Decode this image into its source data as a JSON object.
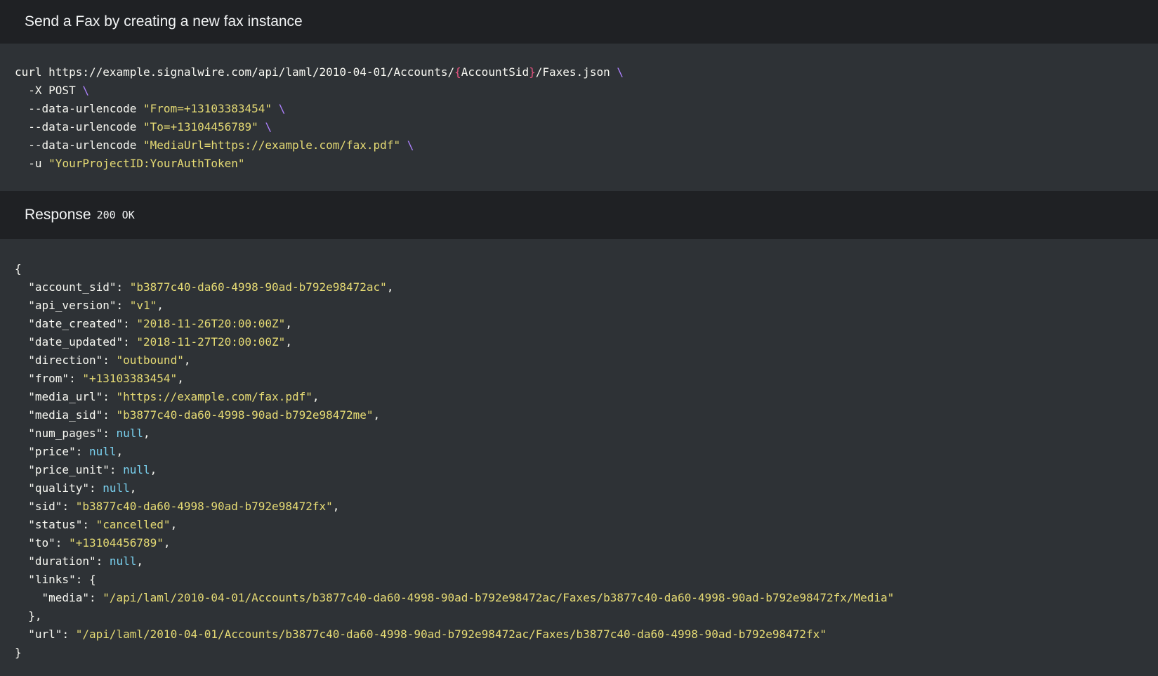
{
  "request": {
    "title": "Send a Fax by creating a new fax instance",
    "curl_lines": [
      {
        "cmd": "curl https://example.signalwire.com/api/laml/2010-04-01/Accounts/",
        "open": "{",
        "var": "AccountSid",
        "close": "}",
        "rest": "/Faxes.json",
        "cont": "\\"
      },
      {
        "indent": "  ",
        "cmd": "-X POST",
        "cont": "\\"
      },
      {
        "indent": "  ",
        "cmd": "--data-urlencode",
        "str": "\"From=+13103383454\"",
        "cont": "\\"
      },
      {
        "indent": "  ",
        "cmd": "--data-urlencode",
        "str": "\"To=+13104456789\"",
        "cont": "\\"
      },
      {
        "indent": "  ",
        "cmd": "--data-urlencode",
        "str": "\"MediaUrl=https://example.com/fax.pdf\"",
        "cont": "\\"
      },
      {
        "indent": "  ",
        "cmd": "-u",
        "str": "\"YourProjectID:YourAuthToken\"",
        "cont": ""
      }
    ]
  },
  "response": {
    "title": "Response",
    "status": "200 OK",
    "open_brace": "{",
    "close_brace": "}",
    "fields": [
      {
        "key": "\"account_sid\"",
        "value": "\"b3877c40-da60-4998-90ad-b792e98472ac\"",
        "type": "str"
      },
      {
        "key": "\"api_version\"",
        "value": "\"v1\"",
        "type": "str"
      },
      {
        "key": "\"date_created\"",
        "value": "\"2018-11-26T20:00:00Z\"",
        "type": "str"
      },
      {
        "key": "\"date_updated\"",
        "value": "\"2018-11-27T20:00:00Z\"",
        "type": "str"
      },
      {
        "key": "\"direction\"",
        "value": "\"outbound\"",
        "type": "str"
      },
      {
        "key": "\"from\"",
        "value": "\"+13103383454\"",
        "type": "str"
      },
      {
        "key": "\"media_url\"",
        "value": "\"https://example.com/fax.pdf\"",
        "type": "str"
      },
      {
        "key": "\"media_sid\"",
        "value": "\"b3877c40-da60-4998-90ad-b792e98472me\"",
        "type": "str"
      },
      {
        "key": "\"num_pages\"",
        "value": "null",
        "type": "null"
      },
      {
        "key": "\"price\"",
        "value": "null",
        "type": "null"
      },
      {
        "key": "\"price_unit\"",
        "value": "null",
        "type": "null"
      },
      {
        "key": "\"quality\"",
        "value": "null",
        "type": "null"
      },
      {
        "key": "\"sid\"",
        "value": "\"b3877c40-da60-4998-90ad-b792e98472fx\"",
        "type": "str"
      },
      {
        "key": "\"status\"",
        "value": "\"cancelled\"",
        "type": "str"
      },
      {
        "key": "\"to\"",
        "value": "\"+13104456789\"",
        "type": "str"
      },
      {
        "key": "\"duration\"",
        "value": "null",
        "type": "null"
      }
    ],
    "links": {
      "key": "\"links\"",
      "media_key": "\"media\"",
      "media_value": "\"/api/laml/2010-04-01/Accounts/b3877c40-da60-4998-90ad-b792e98472ac/Faxes/b3877c40-da60-4998-90ad-b792e98472fx/Media\""
    },
    "url": {
      "key": "\"url\"",
      "value": "\"/api/laml/2010-04-01/Accounts/b3877c40-da60-4998-90ad-b792e98472ac/Faxes/b3877c40-da60-4998-90ad-b792e98472fx\""
    }
  },
  "colors": {
    "header_bg": "#1f2124",
    "code_bg": "#2e3236",
    "string": "#e6db74",
    "null": "#7ad2f0",
    "continuation": "#ae81ff",
    "brace_var": "#e4537f"
  }
}
